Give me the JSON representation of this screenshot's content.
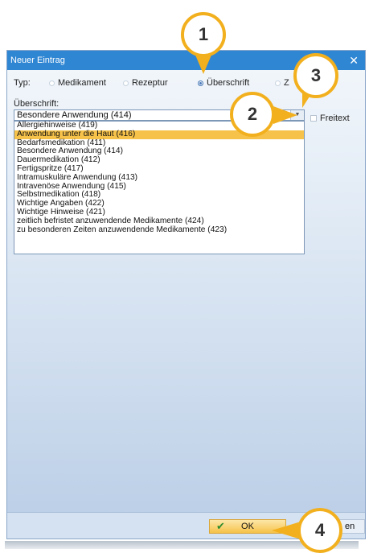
{
  "dialog": {
    "title": "Neuer Eintrag",
    "close_glyph": "✕"
  },
  "typ": {
    "label": "Typ:",
    "options": [
      "Medikament",
      "Rezeptur",
      "Überschrift",
      "Z"
    ],
    "selected": "Überschrift"
  },
  "ueberschrift": {
    "label": "Überschrift:",
    "value": "Besondere Anwendung (414)",
    "items": [
      "Allergiehinweise (419)",
      "Anwendung unter die Haut (416)",
      "Bedarfsmedikation (411)",
      "Besondere Anwendung (414)",
      "Dauermedikation (412)",
      "Fertigspritze (417)",
      "Intramuskuläre Anwendung (413)",
      "Intravenöse Anwendung (415)",
      "Selbstmedikation (418)",
      "Wichtige Angaben (422)",
      "Wichtige Hinweise (421)",
      "zeitlich befristet anzuwendende Medikamente (424)",
      "zu besonderen Zeiten anzuwendende Medikamente (423)"
    ],
    "highlighted": "Anwendung unter die Haut (416)"
  },
  "freitext": {
    "label": "Freitext"
  },
  "buttons": {
    "ok": "OK",
    "cancel_partial": "en"
  },
  "callouts": [
    "1",
    "2",
    "3",
    "4"
  ],
  "colors": {
    "accent": "#2f86d3",
    "highlight": "#f6c24a",
    "callout_ring": "#f2b01e"
  }
}
